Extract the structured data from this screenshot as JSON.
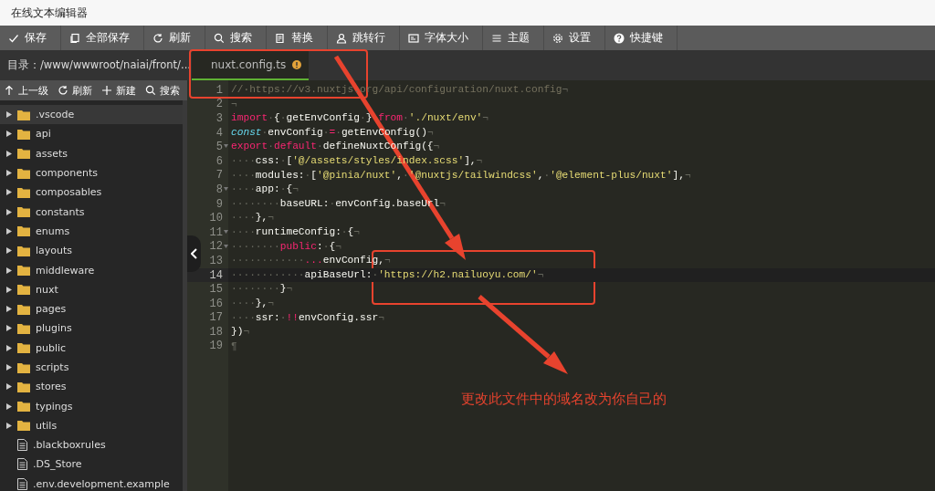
{
  "window": {
    "title": "在线文本编辑器"
  },
  "toolbar": [
    "保存",
    "全部保存",
    "刷新",
    "搜索",
    "替换",
    "跳转行",
    "字体大小",
    "主题",
    "设置",
    "快捷键"
  ],
  "path": "目录：/www/wwwroot/naiai/front/...",
  "file_toolbar": [
    "上一级",
    "刷新",
    "新建",
    "搜索"
  ],
  "files": [
    {
      "name": ".vscode",
      "kind": "folder",
      "expanded": false,
      "selected": true
    },
    {
      "name": "api",
      "kind": "folder",
      "expanded": false,
      "selected": false
    },
    {
      "name": "assets",
      "kind": "folder",
      "expanded": false,
      "selected": false
    },
    {
      "name": "components",
      "kind": "folder",
      "expanded": false,
      "selected": false
    },
    {
      "name": "composables",
      "kind": "folder",
      "expanded": false,
      "selected": false
    },
    {
      "name": "constants",
      "kind": "folder",
      "expanded": false,
      "selected": false
    },
    {
      "name": "enums",
      "kind": "folder",
      "expanded": false,
      "selected": false
    },
    {
      "name": "layouts",
      "kind": "folder",
      "expanded": false,
      "selected": false
    },
    {
      "name": "middleware",
      "kind": "folder",
      "expanded": false,
      "selected": false
    },
    {
      "name": "nuxt",
      "kind": "folder",
      "expanded": false,
      "selected": false
    },
    {
      "name": "pages",
      "kind": "folder",
      "expanded": false,
      "selected": false
    },
    {
      "name": "plugins",
      "kind": "folder",
      "expanded": false,
      "selected": false
    },
    {
      "name": "public",
      "kind": "folder",
      "expanded": false,
      "selected": false
    },
    {
      "name": "scripts",
      "kind": "folder",
      "expanded": false,
      "selected": false
    },
    {
      "name": "stores",
      "kind": "folder",
      "expanded": false,
      "selected": false
    },
    {
      "name": "typings",
      "kind": "folder",
      "expanded": false,
      "selected": false
    },
    {
      "name": "utils",
      "kind": "folder",
      "expanded": false,
      "selected": false
    },
    {
      "name": ".blackboxrules",
      "kind": "file",
      "selected": false
    },
    {
      "name": ".DS_Store",
      "kind": "file",
      "selected": false
    },
    {
      "name": ".env.development.example",
      "kind": "file",
      "selected": false
    }
  ],
  "tabs": [
    {
      "label": "nuxt.config.ts",
      "selected": true,
      "modified": true
    }
  ],
  "code": [
    {
      "number": "1",
      "fold": false,
      "active": false,
      "tokens": [
        {
          "kind": "comment",
          "text": "//·https://v3.nuxtjs.org/api/configuration/nuxt.config"
        },
        {
          "kind": "ws",
          "text": "¬"
        }
      ]
    },
    {
      "number": "2",
      "fold": false,
      "active": false,
      "tokens": [
        {
          "kind": "ws",
          "text": "¬"
        }
      ]
    },
    {
      "number": "3",
      "fold": false,
      "active": false,
      "tokens": [
        {
          "kind": "keyword",
          "text": "import"
        },
        {
          "kind": "ws",
          "text": "·"
        },
        {
          "kind": "plain",
          "text": "{"
        },
        {
          "kind": "ws",
          "text": "·"
        },
        {
          "kind": "plain",
          "text": "getEnvConfig"
        },
        {
          "kind": "ws",
          "text": "·"
        },
        {
          "kind": "plain",
          "text": "} "
        },
        {
          "kind": "keyword",
          "text": "from"
        },
        {
          "kind": "ws",
          "text": "·"
        },
        {
          "kind": "string",
          "text": "'./nuxt/env'"
        },
        {
          "kind": "ws",
          "text": "¬"
        }
      ]
    },
    {
      "number": "4",
      "fold": false,
      "active": false,
      "tokens": [
        {
          "kind": "storage",
          "text": "const"
        },
        {
          "kind": "ws",
          "text": "·"
        },
        {
          "kind": "plain",
          "text": "envConfig"
        },
        {
          "kind": "ws",
          "text": "·"
        },
        {
          "kind": "keyword",
          "text": "="
        },
        {
          "kind": "ws",
          "text": "·"
        },
        {
          "kind": "plain",
          "text": "getEnvConfig()"
        },
        {
          "kind": "ws",
          "text": "¬"
        }
      ]
    },
    {
      "number": "5",
      "fold": true,
      "active": false,
      "tokens": [
        {
          "kind": "keyword",
          "text": "export"
        },
        {
          "kind": "ws",
          "text": "·"
        },
        {
          "kind": "keyword",
          "text": "default"
        },
        {
          "kind": "ws",
          "text": "·"
        },
        {
          "kind": "plain",
          "text": "defineNuxtConfig({"
        },
        {
          "kind": "ws",
          "text": "¬"
        }
      ]
    },
    {
      "number": "6",
      "fold": false,
      "active": false,
      "tokens": [
        {
          "kind": "ws",
          "text": "····"
        },
        {
          "kind": "plain",
          "text": "css:"
        },
        {
          "kind": "ws",
          "text": "·"
        },
        {
          "kind": "plain",
          "text": "["
        },
        {
          "kind": "string",
          "text": "'@/assets/styles/index.scss'"
        },
        {
          "kind": "plain",
          "text": "],"
        },
        {
          "kind": "ws",
          "text": "¬"
        }
      ]
    },
    {
      "number": "7",
      "fold": false,
      "active": false,
      "tokens": [
        {
          "kind": "ws",
          "text": "····"
        },
        {
          "kind": "plain",
          "text": "modules:"
        },
        {
          "kind": "ws",
          "text": "·"
        },
        {
          "kind": "plain",
          "text": "["
        },
        {
          "kind": "string",
          "text": "'@pinia/nuxt'"
        },
        {
          "kind": "plain",
          "text": ","
        },
        {
          "kind": "ws",
          "text": "·"
        },
        {
          "kind": "string",
          "text": "'@nuxtjs/tailwindcss'"
        },
        {
          "kind": "plain",
          "text": ","
        },
        {
          "kind": "ws",
          "text": "·"
        },
        {
          "kind": "string",
          "text": "'@element-plus/nuxt'"
        },
        {
          "kind": "plain",
          "text": "],"
        },
        {
          "kind": "ws",
          "text": "¬"
        }
      ]
    },
    {
      "number": "8",
      "fold": true,
      "active": false,
      "tokens": [
        {
          "kind": "ws",
          "text": "····"
        },
        {
          "kind": "plain",
          "text": "app:"
        },
        {
          "kind": "ws",
          "text": "·"
        },
        {
          "kind": "plain",
          "text": "{"
        },
        {
          "kind": "ws",
          "text": "¬"
        }
      ]
    },
    {
      "number": "9",
      "fold": false,
      "active": false,
      "tokens": [
        {
          "kind": "ws",
          "text": "········"
        },
        {
          "kind": "plain",
          "text": "baseURL:"
        },
        {
          "kind": "ws",
          "text": "·"
        },
        {
          "kind": "plain",
          "text": "envConfig.baseUrl"
        },
        {
          "kind": "ws",
          "text": "¬"
        }
      ]
    },
    {
      "number": "10",
      "fold": false,
      "active": false,
      "tokens": [
        {
          "kind": "ws",
          "text": "····"
        },
        {
          "kind": "plain",
          "text": "},"
        },
        {
          "kind": "ws",
          "text": "¬"
        }
      ]
    },
    {
      "number": "11",
      "fold": true,
      "active": false,
      "tokens": [
        {
          "kind": "ws",
          "text": "····"
        },
        {
          "kind": "plain",
          "text": "runtimeConfig:"
        },
        {
          "kind": "ws",
          "text": "·"
        },
        {
          "kind": "plain",
          "text": "{"
        },
        {
          "kind": "ws",
          "text": "¬"
        }
      ]
    },
    {
      "number": "12",
      "fold": true,
      "active": false,
      "tokens": [
        {
          "kind": "ws",
          "text": "········"
        },
        {
          "kind": "keyword",
          "text": "public"
        },
        {
          "kind": "plain",
          "text": ":"
        },
        {
          "kind": "ws",
          "text": "·"
        },
        {
          "kind": "plain",
          "text": "{"
        },
        {
          "kind": "ws",
          "text": "¬"
        }
      ]
    },
    {
      "number": "13",
      "fold": false,
      "active": false,
      "tokens": [
        {
          "kind": "ws",
          "text": "············"
        },
        {
          "kind": "keyword",
          "text": "..."
        },
        {
          "kind": "plain",
          "text": "envConfig,"
        },
        {
          "kind": "ws",
          "text": "¬"
        }
      ]
    },
    {
      "number": "14",
      "fold": false,
      "active": true,
      "tokens": [
        {
          "kind": "ws",
          "text": "············"
        },
        {
          "kind": "plain",
          "text": "apiBaseUrl:"
        },
        {
          "kind": "ws",
          "text": "·"
        },
        {
          "kind": "string",
          "text": "'https://h2.nailuoyu.com/'"
        },
        {
          "kind": "ws",
          "text": "¬"
        }
      ]
    },
    {
      "number": "15",
      "fold": false,
      "active": false,
      "tokens": [
        {
          "kind": "ws",
          "text": "········"
        },
        {
          "kind": "plain",
          "text": "}"
        },
        {
          "kind": "ws",
          "text": "¬"
        }
      ]
    },
    {
      "number": "16",
      "fold": false,
      "active": false,
      "tokens": [
        {
          "kind": "ws",
          "text": "····"
        },
        {
          "kind": "plain",
          "text": "},"
        },
        {
          "kind": "ws",
          "text": "¬"
        }
      ]
    },
    {
      "number": "17",
      "fold": false,
      "active": false,
      "tokens": [
        {
          "kind": "ws",
          "text": "····"
        },
        {
          "kind": "plain",
          "text": "ssr:"
        },
        {
          "kind": "ws",
          "text": "·"
        },
        {
          "kind": "keyword",
          "text": "!!"
        },
        {
          "kind": "plain",
          "text": "envConfig.ssr"
        },
        {
          "kind": "ws",
          "text": "¬"
        }
      ]
    },
    {
      "number": "18",
      "fold": false,
      "active": false,
      "tokens": [
        {
          "kind": "plain",
          "text": "})"
        },
        {
          "kind": "ws",
          "text": "¬"
        }
      ]
    },
    {
      "number": "19",
      "fold": false,
      "active": false,
      "tokens": [
        {
          "kind": "ws",
          "text": "¶"
        }
      ]
    }
  ],
  "annotation": {
    "note": "更改此文件中的域名改为你自己的"
  }
}
